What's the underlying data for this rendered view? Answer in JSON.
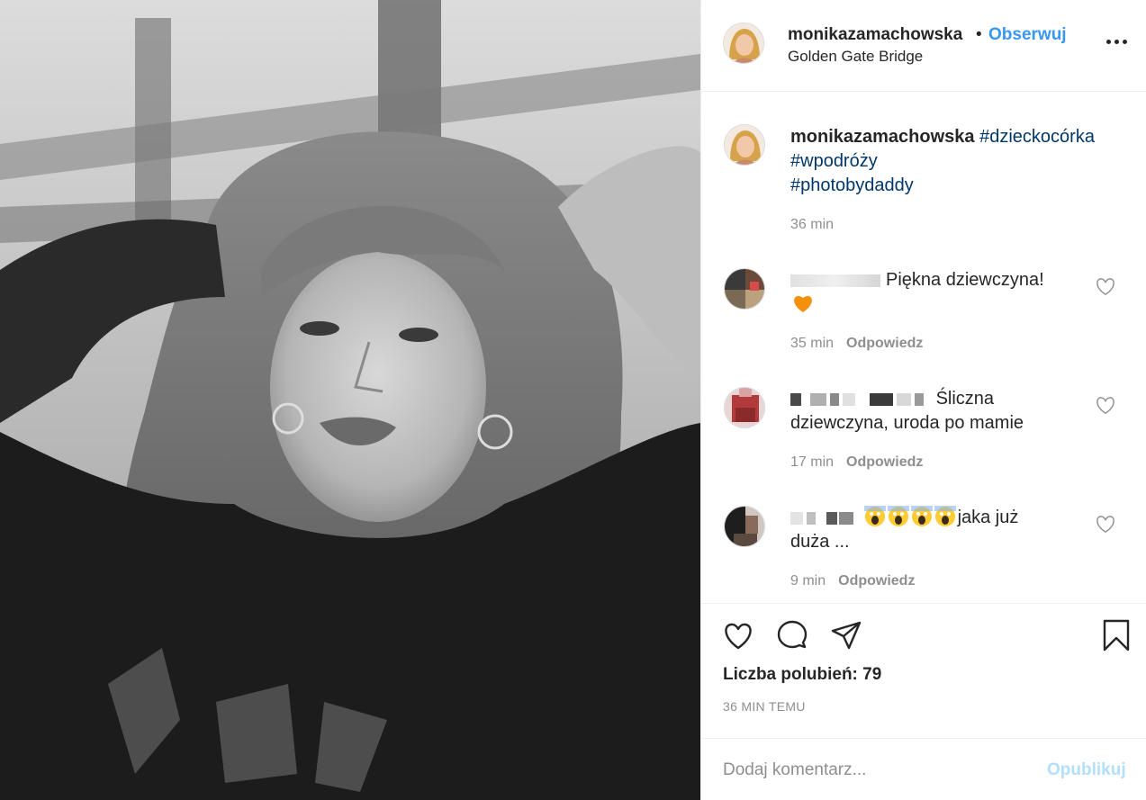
{
  "photo": {
    "alt_icon": "photo-image"
  },
  "header": {
    "username": "monikazamachowska",
    "separator": "•",
    "follow_label": "Obserwuj",
    "location": "Golden Gate Bridge",
    "more_icon": "more-options-icon"
  },
  "caption": {
    "username": "monikazamachowska",
    "hashtags": [
      "#dzieckocórka",
      "#wpodróży",
      "#photobydaddy"
    ],
    "time": "36 min"
  },
  "comments": [
    {
      "text": "Piękna dziewczyna!",
      "time": "35 min",
      "reply_label": "Odpowiedz",
      "emoji": "orange-heart"
    },
    {
      "text_line1": "Śliczna",
      "text_line2": "dziewczyna, uroda po mamie",
      "time": "17 min",
      "reply_label": "Odpowiedz"
    },
    {
      "text_line1": "jaka już",
      "text_line2": "duża ...",
      "time": "9 min",
      "reply_label": "Odpowiedz",
      "emoji": "screaming-face"
    }
  ],
  "actions": {
    "likes_label": "Liczba polubień: 79",
    "time_ago": "36 MIN TEMU"
  },
  "add_comment": {
    "placeholder": "Dodaj komentarz...",
    "post_label": "Opublikuj"
  },
  "colors": {
    "link_blue": "#3897f0",
    "hashtag": "#00376b",
    "muted": "#8e8e8e",
    "post_disabled": "#b2dffc"
  }
}
